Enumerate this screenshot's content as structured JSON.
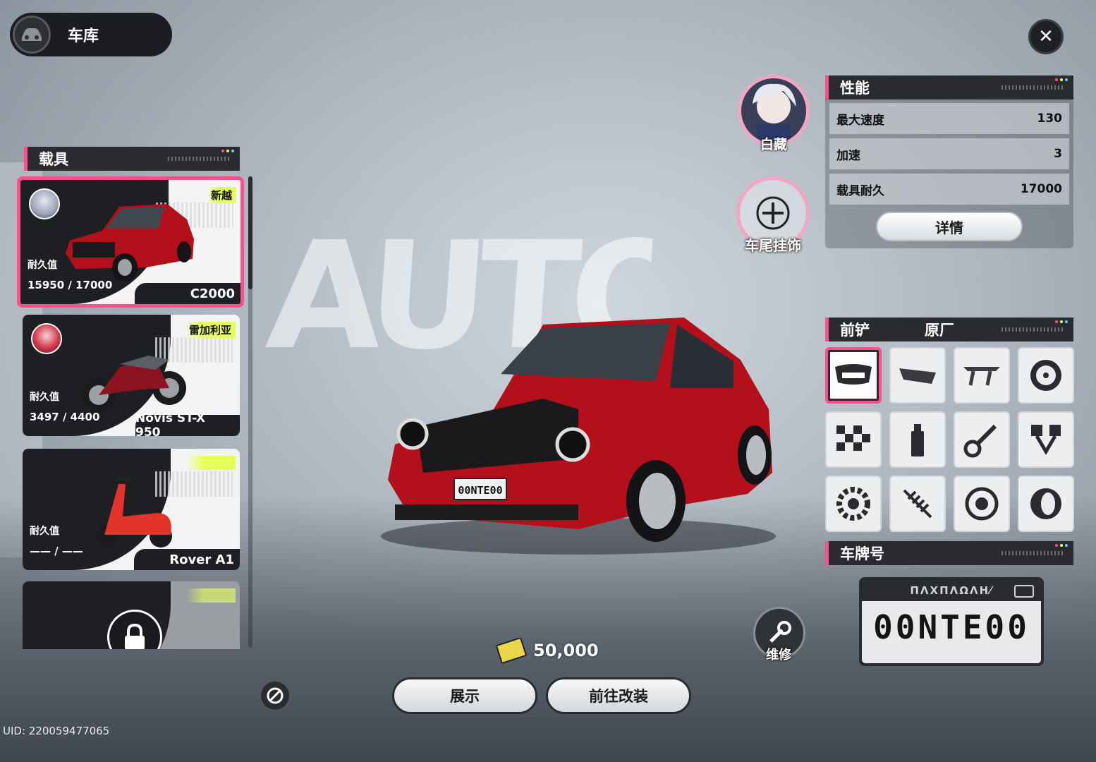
{
  "header": {
    "title": "车库"
  },
  "background_text": "AUTO MO",
  "vehicles_panel": {
    "title": "载具",
    "cards": [
      {
        "badge": "新越",
        "durability_label": "耐久值",
        "durability": "15950 / 17000",
        "name": "C2000",
        "selected": true
      },
      {
        "badge": "雷加利亚",
        "durability_label": "耐久值",
        "durability": "3497 / 4400",
        "name": "Novis ST-X 950",
        "selected": false
      },
      {
        "badge": "",
        "durability_label": "耐久值",
        "durability": "—— / ——",
        "name": "Rover A1",
        "selected": false
      },
      {
        "badge": "",
        "durability_label": "",
        "durability": "",
        "name": "",
        "selected": false,
        "locked": true
      }
    ]
  },
  "character": {
    "name": "白藏"
  },
  "tail_ornament": {
    "label": "车尾挂饰"
  },
  "performance": {
    "title": "性能",
    "rows": [
      {
        "label": "最大速度",
        "value": "130"
      },
      {
        "label": "加速",
        "value": "3"
      },
      {
        "label": "载具耐久",
        "value": "17000"
      }
    ],
    "detail_label": "详情"
  },
  "parts": {
    "title": "前铲",
    "current": "原厂",
    "icons": [
      "front-bumper-icon",
      "rear-bumper-icon",
      "spoiler-icon",
      "wheel-rim-icon",
      "checker-livery-icon",
      "spray-can-icon",
      "suspension-arm-icon",
      "piston-icon",
      "turbo-gear-icon",
      "spring-icon",
      "brake-disc-icon",
      "tire-icon"
    ]
  },
  "plate": {
    "title": "车牌号",
    "brand": "ΠΛΧΠΛΩΛΗ⁄",
    "number": "00NTE00"
  },
  "currency": {
    "amount": "50,000"
  },
  "repair": {
    "label": "维修"
  },
  "actions": {
    "display_label": "展示",
    "modify_label": "前往改装"
  },
  "uid": "UID: 220059477065",
  "colors": {
    "accent": "#ff4f8b",
    "panel": "#2a2b2f",
    "badge": "#e8ff5a"
  }
}
